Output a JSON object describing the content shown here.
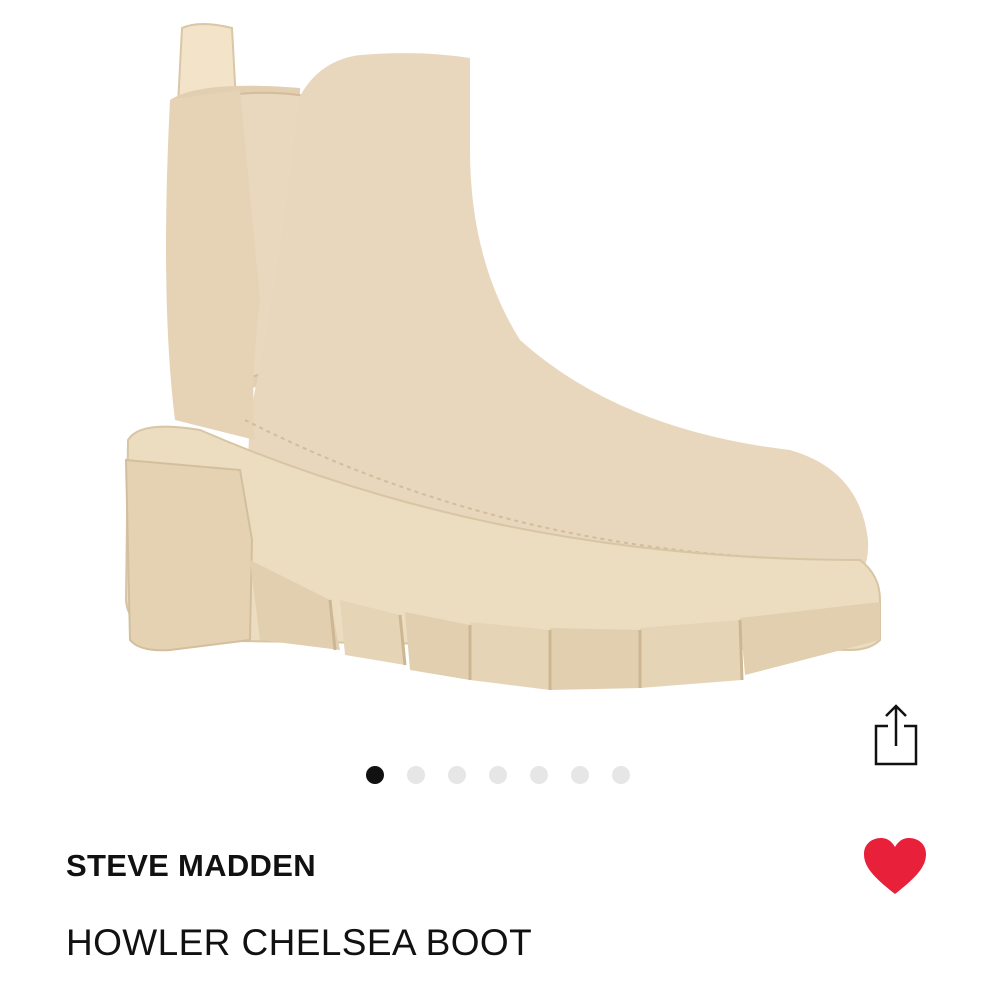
{
  "product": {
    "brand": "STEVE MADDEN",
    "name": "HOWLER CHELSEA BOOT",
    "image_alt_icon": "boot-image"
  },
  "carousel": {
    "total_slides": 7,
    "active_index": 0
  },
  "actions": {
    "share_icon": "share-icon",
    "favorite_icon": "heart-icon",
    "favorite_active": true
  },
  "colors": {
    "boot": "#e8d7bd",
    "sole": "#e4d4b7",
    "heart": "#e8203a",
    "dot_active": "#111111",
    "dot_inactive": "#e6e6e6"
  }
}
